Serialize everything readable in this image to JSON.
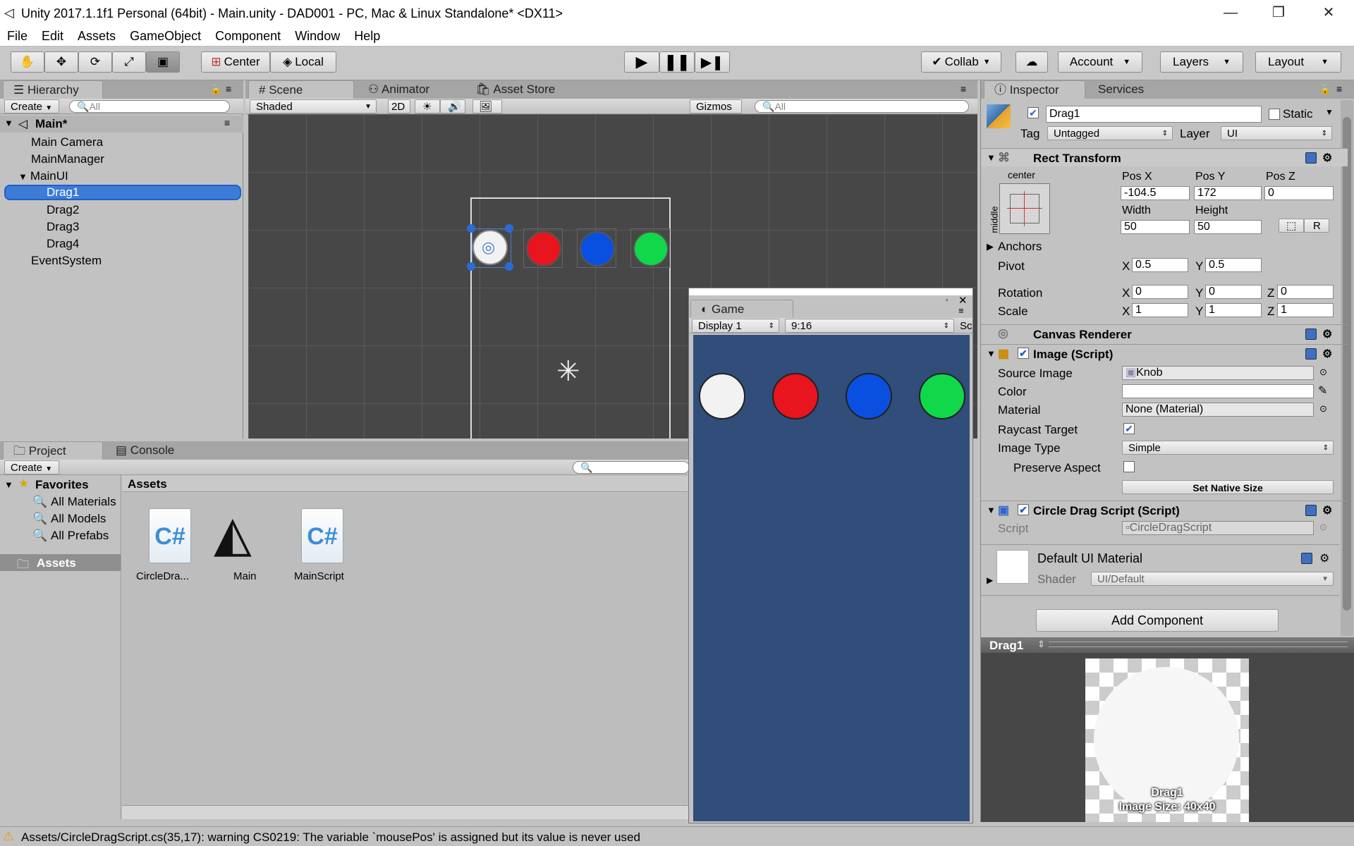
{
  "window": {
    "title": "Unity 2017.1.1f1 Personal (64bit) - Main.unity - DAD001 - PC, Mac & Linux Standalone* <DX11>",
    "min": "—",
    "max": "❐",
    "close": "✕"
  },
  "menu": [
    "File",
    "Edit",
    "Assets",
    "GameObject",
    "Component",
    "Window",
    "Help"
  ],
  "toolbar": {
    "center": "Center",
    "local": "Local",
    "collab": "Collab",
    "account": "Account",
    "layers": "Layers",
    "layout": "Layout"
  },
  "hierarchy": {
    "tab": "Hierarchy",
    "create": "Create",
    "search": "All",
    "scene": "Main*",
    "items": [
      "Main Camera",
      "MainManager",
      "MainUI",
      "Drag1",
      "Drag2",
      "Drag3",
      "Drag4",
      "EventSystem"
    ]
  },
  "scene": {
    "tabs": [
      "Scene",
      "Animator",
      "Asset Store"
    ],
    "shaded": "Shaded",
    "mode2d": "2D",
    "gizmos": "Gizmos",
    "search": "All"
  },
  "game": {
    "tab": "Game",
    "display": "Display 1",
    "aspect": "9:16",
    "scale": "Sc"
  },
  "project": {
    "tabs": [
      "Project",
      "Console"
    ],
    "create": "Create",
    "favorites": "Favorites",
    "favItems": [
      "All Materials",
      "All Models",
      "All Prefabs"
    ],
    "assetsRoot": "Assets",
    "assetsHeader": "Assets",
    "files": [
      {
        "name": "CircleDra...",
        "icon": "C#"
      },
      {
        "name": "Main",
        "icon": "unity"
      },
      {
        "name": "MainScript",
        "icon": "C#"
      }
    ]
  },
  "inspector": {
    "tabs": [
      "Inspector",
      "Services"
    ],
    "name": "Drag1",
    "static": "Static",
    "tagLabel": "Tag",
    "tag": "Untagged",
    "layerLabel": "Layer",
    "layer": "UI",
    "rect": {
      "title": "Rect Transform",
      "anchorH": "center",
      "anchorV": "middle",
      "posX": "Pos X",
      "posY": "Pos Y",
      "posZ": "Pos Z",
      "vx": "-104.5",
      "vy": "172",
      "vz": "0",
      "width": "Width",
      "height": "Height",
      "w": "50",
      "h": "50",
      "r": "R",
      "anchors": "Anchors",
      "pivot": "Pivot",
      "px": "0.5",
      "py": "0.5",
      "rotation": "Rotation",
      "rx": "0",
      "ry": "0",
      "rz": "0",
      "scale": "Scale",
      "sx": "1",
      "sy": "1",
      "sz": "1",
      "X": "X",
      "Y": "Y",
      "Z": "Z"
    },
    "canvasRenderer": "Canvas Renderer",
    "image": {
      "title": "Image (Script)",
      "sourceImage": "Source Image",
      "source": "Knob",
      "color": "Color",
      "material": "Material",
      "materialVal": "None (Material)",
      "raycast": "Raycast Target",
      "imageType": "Image Type",
      "imageTypeVal": "Simple",
      "preserve": "Preserve Aspect",
      "setNative": "Set Native Size"
    },
    "drag": {
      "title": "Circle Drag Script (Script)",
      "script": "Script",
      "scriptVal": "CircleDragScript"
    },
    "material": {
      "title": "Default UI Material",
      "shader": "Shader",
      "shaderVal": "UI/Default"
    },
    "addComponent": "Add Component",
    "preview": {
      "title": "Drag1",
      "caption1": "Drag1",
      "caption2": "Image Size: 40x40"
    }
  },
  "status": "Assets/CircleDragScript.cs(35,17): warning CS0219: The variable `mousePos' is assigned but its value is never used",
  "colors": {
    "white": "#f2f2f2",
    "red": "#e8141e",
    "blue": "#0a50e0",
    "green": "#10d84a",
    "gameBg": "#314d79",
    "sceneBg": "#474747"
  }
}
